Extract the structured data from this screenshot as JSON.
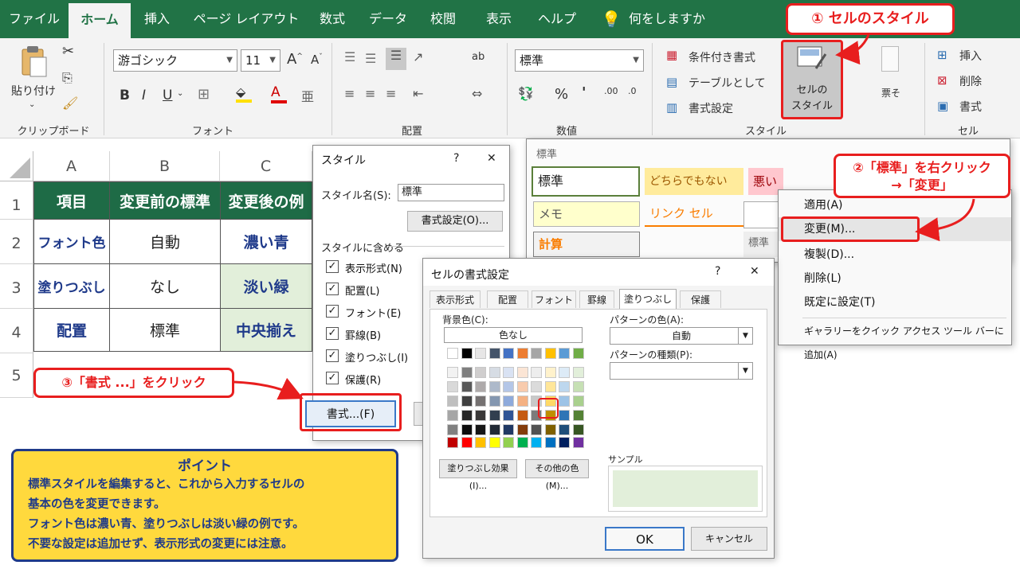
{
  "ribbon_tabs": [
    "ファイル",
    "ホーム",
    "挿入",
    "ページ レイアウト",
    "数式",
    "データ",
    "校閲",
    "表示",
    "ヘルプ"
  ],
  "tell_me": "何をしますか",
  "groups": {
    "clipboard": {
      "label": "クリップボード",
      "paste": "貼り付け"
    },
    "font": {
      "label": "フォント",
      "font_name": "游ゴシック",
      "font_size": "11"
    },
    "alignment": {
      "label": "配置",
      "wrap": "ab"
    },
    "number": {
      "label": "数値",
      "format": "標準",
      "percent": "%",
      "comma": "'",
      "inc_dec": ".00",
      "dec_dec": ".0"
    },
    "styles": {
      "label": "スタイル",
      "conditional": "条件付き書式",
      "as_table": "テーブルとして",
      "cell_format": "書式設定",
      "cell_styles_line1": "セルの",
      "cell_styles_line2": "スタイル"
    },
    "cells": {
      "label": "セル",
      "insert": "挿入",
      "delete": "削除",
      "format": "書式"
    },
    "extra": "票そ"
  },
  "sheet": {
    "columns": [
      "A",
      "B",
      "C"
    ],
    "rows": [
      "1",
      "2",
      "3",
      "4",
      "5"
    ],
    "header": [
      "項目",
      "変更前の標準",
      "変更後の例"
    ],
    "data": [
      [
        "フォント色",
        "自動",
        "濃い青"
      ],
      [
        "塗りつぶし",
        "なし",
        "淡い緑"
      ],
      [
        "配置",
        "標準",
        "中央揃え"
      ]
    ]
  },
  "style_dialog": {
    "title": "スタイル",
    "help": "?",
    "close": "✕",
    "name_label": "スタイル名(S):",
    "name_value": "標準",
    "format_button": "書式設定(O)...",
    "includes_label": "スタイルに含める",
    "checks": [
      "表示形式(N)",
      "配置(L)",
      "フォント(E)",
      "罫線(B)",
      "塗りつぶし(I)",
      "保護(R)"
    ],
    "format_btn": "書式...(F)"
  },
  "gallery": {
    "header": "標準",
    "items": [
      "標準",
      "どちらでもない",
      "悪い",
      "メモ",
      "リンク セル",
      "計算",
      "標準"
    ]
  },
  "context_menu": {
    "items": [
      "適用(A)",
      "変更(M)...",
      "複製(D)...",
      "削除(L)",
      "既定に設定(T)",
      "ギャラリーをクイック アクセス ツール バーに追加(A)"
    ]
  },
  "format_dialog": {
    "title": "セルの書式設定",
    "help": "?",
    "close": "✕",
    "tabs": [
      "表示形式",
      "配置",
      "フォント",
      "罫線",
      "塗りつぶし",
      "保護"
    ],
    "bg_label": "背景色(C):",
    "no_color": "色なし",
    "pattern_color_label": "パターンの色(A):",
    "pattern_color_value": "自動",
    "pattern_type_label": "パターンの種類(P):",
    "fill_effects": "塗りつぶし効果(I)...",
    "more_colors": "その他の色(M)...",
    "sample_label": "サンプル",
    "ok": "OK",
    "cancel": "キャンセル"
  },
  "callouts": {
    "c1": "① セルのスタイル",
    "c2_line1": "②「標準」を右クリック",
    "c2_line2": "→「変更」",
    "c3": "③「書式 ...」をクリック"
  },
  "point": {
    "title": "ポイント",
    "lines": [
      "標準スタイルを編集すると、これから入力するセルの",
      "基本の色を変更できます。",
      "フォント色は濃い青、塗りつぶしは淡い緑の例です。",
      "不要な設定は追加せず、表示形式の変更には注意。"
    ]
  },
  "colors": {
    "excel_green": "#217346",
    "header_fill": "#1e6b46",
    "dark_blue": "#1f3a8a",
    "light_green": "#e2efda",
    "callout_red": "#e81e1e",
    "point_yellow": "#ffd93d",
    "point_border": "#1f3a8a"
  }
}
